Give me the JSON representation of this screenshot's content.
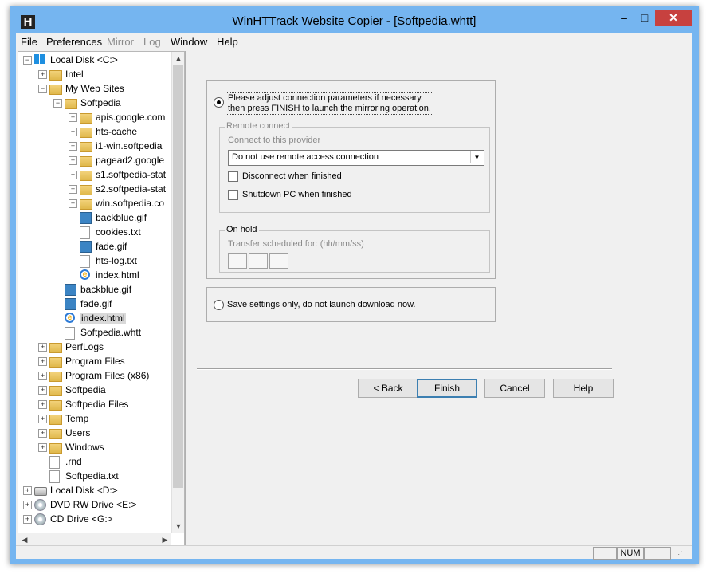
{
  "window": {
    "title": "WinHTTrack Website Copier - [Softpedia.whtt]",
    "app_icon_letter": "H",
    "caption": {
      "minimize": "–",
      "maximize": "□",
      "close": "✕"
    }
  },
  "menubar": {
    "items": [
      {
        "label": "File"
      },
      {
        "label": "Preferences"
      },
      {
        "label": "Mirror"
      },
      {
        "label": "Log"
      },
      {
        "label": "Window"
      },
      {
        "label": "Help"
      }
    ]
  },
  "tree": {
    "nodes": [
      {
        "label": "Local Disk <C:>",
        "icon": "windows-drive-icon",
        "expander": "−"
      },
      {
        "label": "Intel",
        "icon": "folder-icon",
        "expander": "+"
      },
      {
        "label": "My Web Sites",
        "icon": "folder-icon",
        "expander": "−"
      },
      {
        "label": "Softpedia",
        "icon": "folder-icon",
        "expander": "−"
      },
      {
        "label": "apis.google.com",
        "icon": "folder-icon",
        "expander": "+"
      },
      {
        "label": "hts-cache",
        "icon": "folder-icon",
        "expander": "+"
      },
      {
        "label": "i1-win.softpedia",
        "icon": "folder-icon",
        "expander": "+"
      },
      {
        "label": "pagead2.google",
        "icon": "folder-icon",
        "expander": "+"
      },
      {
        "label": "s1.softpedia-stat",
        "icon": "folder-icon",
        "expander": "+"
      },
      {
        "label": "s2.softpedia-stat",
        "icon": "folder-icon",
        "expander": "+"
      },
      {
        "label": "win.softpedia.co",
        "icon": "folder-icon",
        "expander": "+"
      },
      {
        "label": "backblue.gif",
        "icon": "image-file-icon"
      },
      {
        "label": "cookies.txt",
        "icon": "text-file-icon"
      },
      {
        "label": "fade.gif",
        "icon": "image-file-icon"
      },
      {
        "label": "hts-log.txt",
        "icon": "text-file-icon"
      },
      {
        "label": "index.html",
        "icon": "html-file-icon"
      },
      {
        "label": "backblue.gif",
        "icon": "image-file-icon"
      },
      {
        "label": "fade.gif",
        "icon": "image-file-icon"
      },
      {
        "label": "index.html",
        "icon": "html-file-icon",
        "selected": true
      },
      {
        "label": "Softpedia.whtt",
        "icon": "text-file-icon"
      },
      {
        "label": "PerfLogs",
        "icon": "folder-icon",
        "expander": "+"
      },
      {
        "label": "Program Files",
        "icon": "folder-icon",
        "expander": "+"
      },
      {
        "label": "Program Files (x86)",
        "icon": "folder-icon",
        "expander": "+"
      },
      {
        "label": "Softpedia",
        "icon": "folder-icon",
        "expander": "+"
      },
      {
        "label": "Softpedia Files",
        "icon": "folder-icon",
        "expander": "+"
      },
      {
        "label": "Temp",
        "icon": "folder-icon",
        "expander": "+"
      },
      {
        "label": "Users",
        "icon": "folder-icon",
        "expander": "+"
      },
      {
        "label": "Windows",
        "icon": "folder-icon",
        "expander": "+"
      },
      {
        "label": ".rnd",
        "icon": "text-file-icon"
      },
      {
        "label": "Softpedia.txt",
        "icon": "text-file-icon"
      },
      {
        "label": "Local Disk <D:>",
        "icon": "drive-icon",
        "expander": "+"
      },
      {
        "label": "DVD RW Drive <E:>",
        "icon": "dvd-drive-icon",
        "expander": "+"
      },
      {
        "label": "CD Drive <G:>",
        "icon": "cd-drive-icon",
        "expander": "+"
      }
    ]
  },
  "wizard": {
    "option_launch": "Please adjust connection parameters if necessary,\nthen press FINISH to launch the mirroring operation.",
    "remote_connect": {
      "legend": "Remote connect",
      "provider_label": "Connect to this provider",
      "provider_value": "Do not use remote access connection",
      "disconnect_label": "Disconnect when finished",
      "shutdown_label": "Shutdown PC when finished"
    },
    "on_hold": {
      "legend": "On hold",
      "transfer_label": "Transfer scheduled for: (hh/mm/ss)"
    },
    "option_save": "Save settings only, do not launch download now.",
    "buttons": {
      "back": "< Back",
      "finish": "Finish",
      "cancel": "Cancel",
      "help": "Help"
    }
  },
  "statusbar": {
    "num": "NUM"
  }
}
